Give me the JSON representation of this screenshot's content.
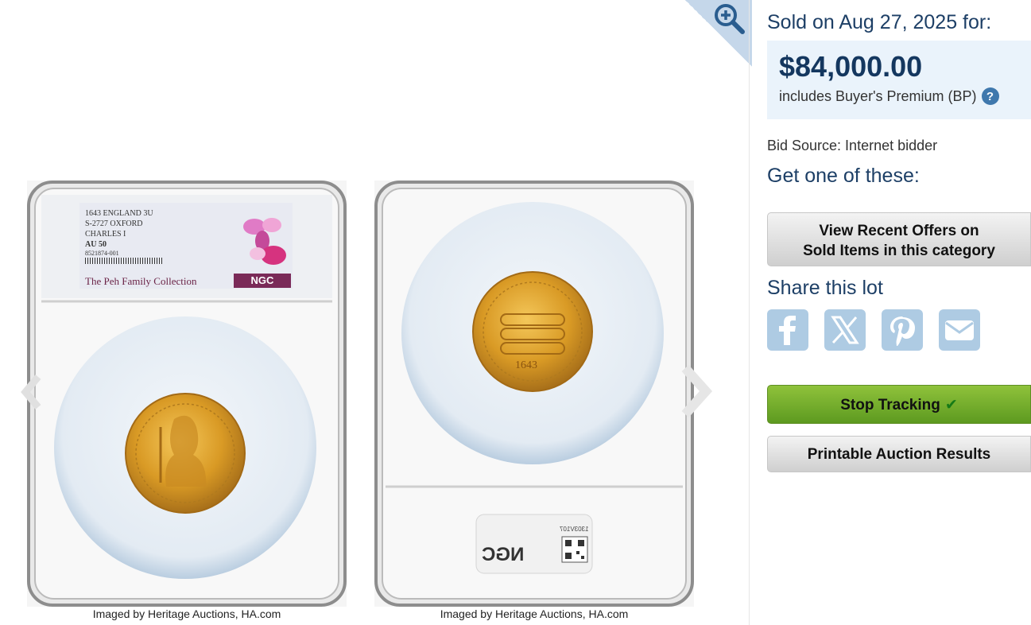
{
  "gallery": {
    "obverse_label": {
      "line1": "1643 ENGLAND 3U",
      "line2": "S-2727 OXFORD",
      "line3": "CHARLES I",
      "grade": "AU 50",
      "cert": "8521874-001",
      "collection": "The Peh Family Collection",
      "grader": "NGC"
    },
    "reverse_label": {
      "grader": "NGC",
      "cert": "1303V107"
    },
    "captions": [
      "Imaged by Heritage Auctions, HA.com",
      "Imaged by Heritage Auctions, HA.com"
    ],
    "coin_reverse_date": "1643"
  },
  "result": {
    "sold_label": "Sold on Aug 27, 2025 for:",
    "price": "$84,000.00",
    "bp_text": "includes Buyer's Premium (BP)",
    "bp_help": "?",
    "bid_source": "Bid Source: Internet bidder"
  },
  "get_one": {
    "heading": "Get one of these:",
    "offers_line1": "View Recent Offers on",
    "offers_line2": "Sold Items in this category"
  },
  "share": {
    "heading": "Share this lot",
    "icons": [
      "facebook-icon",
      "x-icon",
      "pinterest-icon",
      "email-icon"
    ]
  },
  "actions": {
    "stop_tracking": "Stop Tracking",
    "check": "✔",
    "printable": "Printable Auction Results"
  },
  "colors": {
    "accent_blue": "#1d3f66",
    "price_box_bg": "#eaf3fb",
    "tracking_green": "#7ab030",
    "share_icon_bg": "#aecbe3"
  }
}
